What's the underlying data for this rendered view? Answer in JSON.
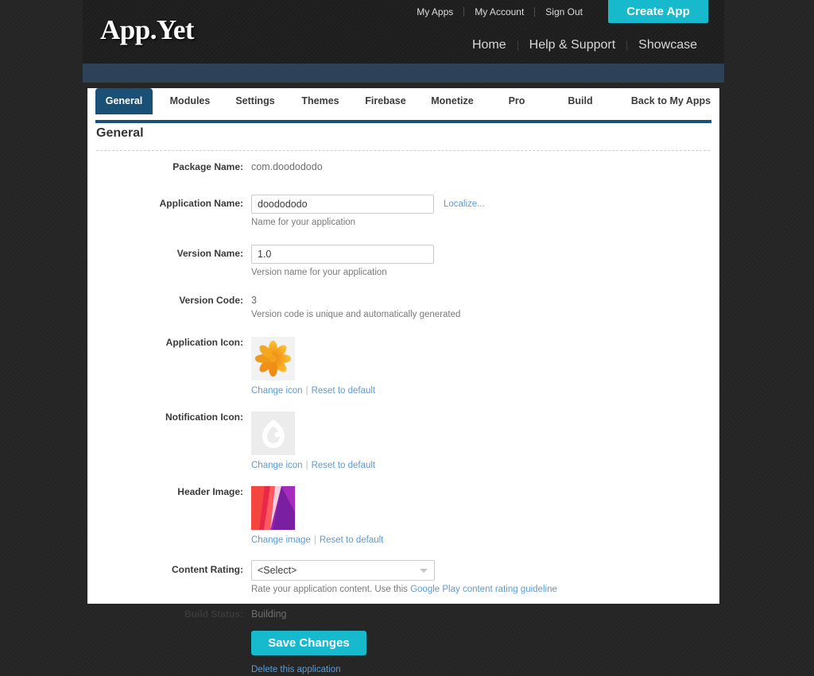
{
  "header": {
    "logo": "App.Yet",
    "top_links": [
      "My Apps",
      "My Account",
      "Sign Out"
    ],
    "create_app_label": "Create App",
    "main_nav": [
      "Home",
      "Help & Support",
      "Showcase"
    ]
  },
  "tabs": [
    {
      "label": "General",
      "active": true
    },
    {
      "label": "Modules",
      "active": false
    },
    {
      "label": "Settings",
      "active": false
    },
    {
      "label": "Themes",
      "active": false
    },
    {
      "label": "Firebase",
      "active": false
    },
    {
      "label": "Monetize",
      "active": false
    },
    {
      "label": "Pro",
      "active": false
    },
    {
      "label": "Build",
      "active": false
    },
    {
      "label": "Back to My Apps",
      "active": false
    }
  ],
  "page": {
    "title": "General"
  },
  "form": {
    "package_name": {
      "label": "Package Name:",
      "value": "com.doodododo"
    },
    "application_name": {
      "label": "Application Name:",
      "value": "doodododo",
      "localize_link": "Localize...",
      "helper": "Name for your application"
    },
    "version_name": {
      "label": "Version Name:",
      "value": "1.0",
      "helper": "Version name for your application"
    },
    "version_code": {
      "label": "Version Code:",
      "value": "3",
      "helper": "Version code is unique and automatically generated"
    },
    "application_icon": {
      "label": "Application Icon:",
      "change_link": "Change icon",
      "separator": "|",
      "reset_link": "Reset to default"
    },
    "notification_icon": {
      "label": "Notification Icon:",
      "change_link": "Change icon",
      "separator": "|",
      "reset_link": "Reset to default"
    },
    "header_image": {
      "label": "Header Image:",
      "change_link": "Change image",
      "separator": "|",
      "reset_link": "Reset to default"
    },
    "content_rating": {
      "label": "Content Rating:",
      "value": "<Select>",
      "helper_prefix": "Rate your application content. Use this ",
      "helper_link": "Google Play content rating guideline"
    },
    "build_status": {
      "label": "Build Status:",
      "value": "Building"
    },
    "save_label": "Save Changes",
    "delete_link": "Delete this application"
  },
  "colors": {
    "accent_cyan": "#17b9cc",
    "navy": "#1a5076",
    "band_navy": "#2d4256",
    "link_blue": "#5b9bd5",
    "header_dark": "#1f1f1f"
  }
}
